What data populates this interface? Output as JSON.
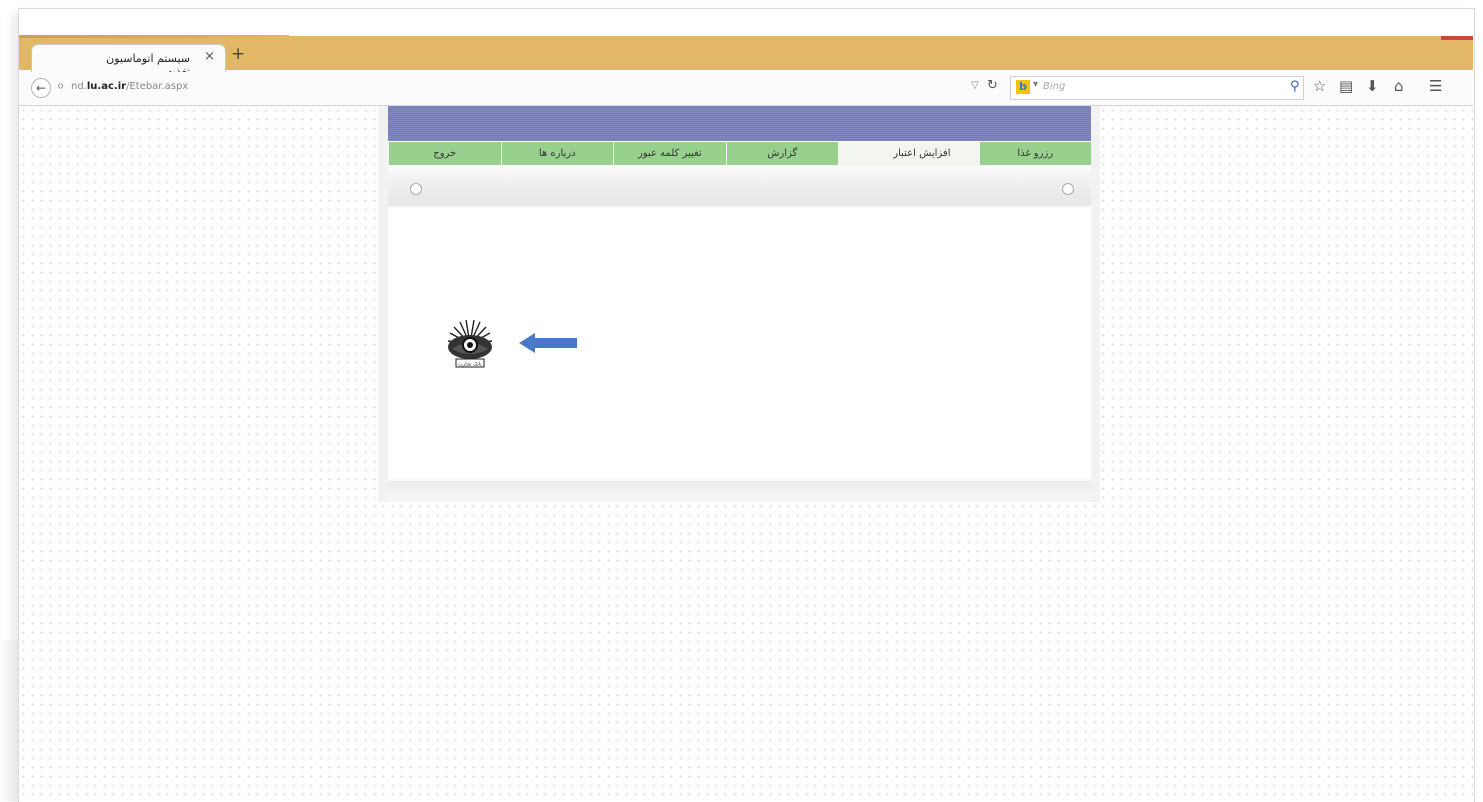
{
  "browser": {
    "tab_title": "سیستم اتوماسیون تغذیه",
    "tab_close": "×",
    "new_tab": "+",
    "url_prefix": "nd.",
    "url_domain": "lu.ac.ir",
    "url_path": "/Etebar.aspx",
    "search_placeholder": "Bing",
    "back_icon": "back-arrow-icon",
    "icons": [
      "reload-icon",
      "search-icon",
      "bookmark-star-icon",
      "reading-list-icon",
      "download-icon",
      "home-icon",
      "menu-icon"
    ]
  },
  "site": {
    "menu": [
      "رزرو غذا",
      "افزایش اعتبار",
      "گزارش",
      "تغییر کلمه عبور",
      "درباره ها",
      "خروج"
    ],
    "active_menu_index": 1,
    "header_color": "#7b7fbc",
    "menu_color": "#98d08e",
    "logo_label": "بانک تجارت",
    "arrow_color": "#4a78c8"
  }
}
